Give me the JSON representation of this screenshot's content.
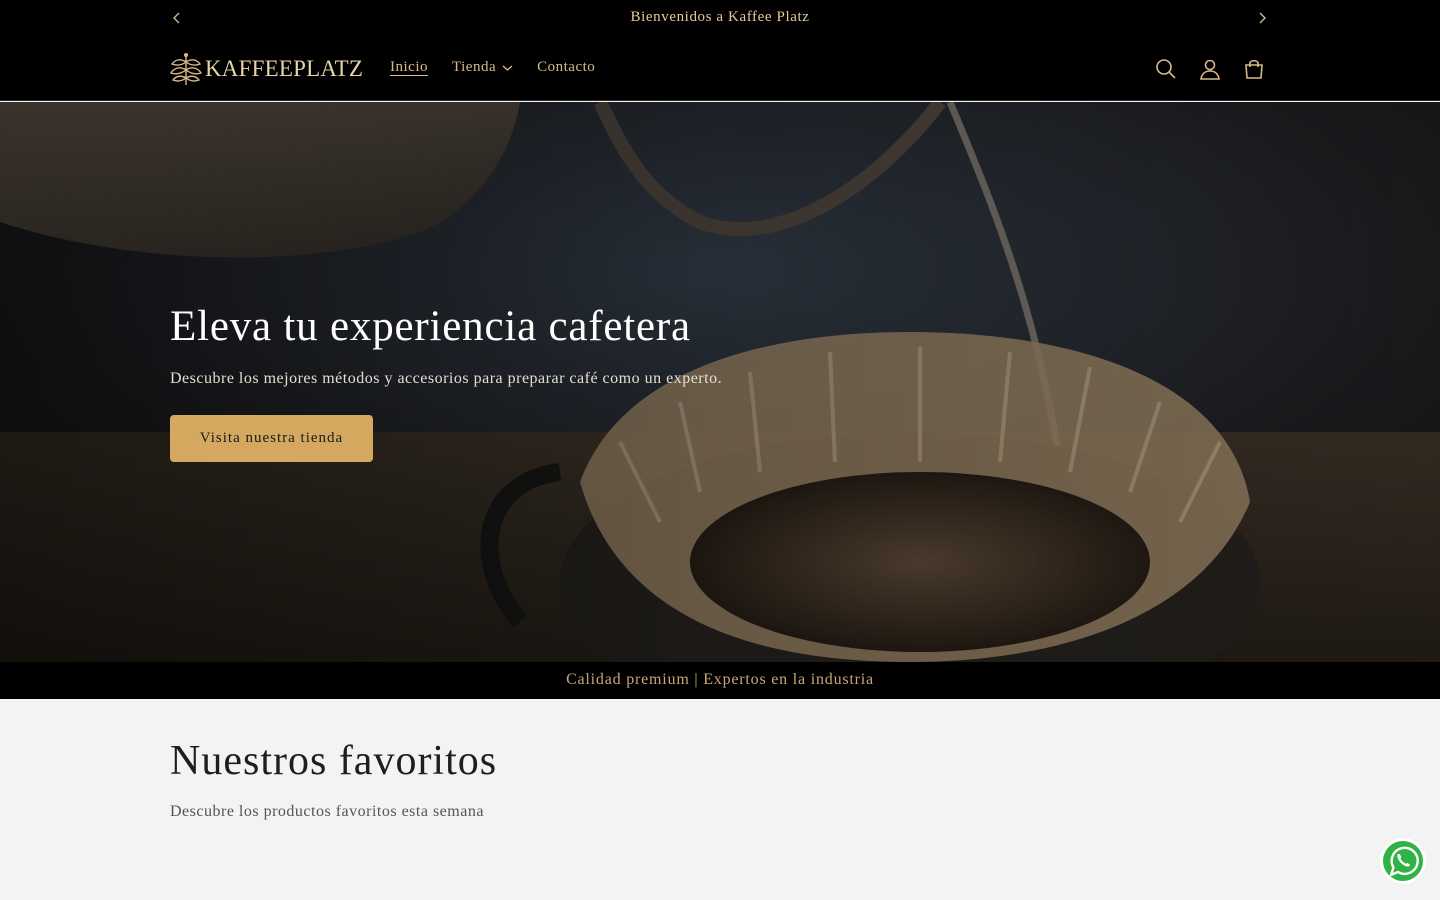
{
  "announcement": {
    "message": "Bienvenidos a Kaffee Platz",
    "prev_icon": "chevron-left-icon",
    "next_icon": "chevron-right-icon"
  },
  "header": {
    "logo_text": "KAFFEEPLATZ",
    "nav": [
      {
        "label": "Inicio",
        "active": true
      },
      {
        "label": "Tienda",
        "has_dropdown": true
      },
      {
        "label": "Contacto"
      }
    ],
    "icons": [
      "search-icon",
      "account-icon",
      "cart-icon"
    ]
  },
  "hero": {
    "title": "Eleva tu experiencia cafetera",
    "subtitle": "Descubre los mejores métodos y accesorios para preparar café como un experto.",
    "cta_label": "Visita nuestra tienda"
  },
  "strip": {
    "text": "Calidad premium | Expertos en la industria"
  },
  "favorites": {
    "title": "Nuestros favoritos",
    "subtitle": "Descubre los productos favoritos esta semana"
  },
  "colors": {
    "accent": "#d4a95f",
    "nav_text": "#d9b98a",
    "background_dark": "#000000",
    "page_bg": "#f3f3f3"
  }
}
